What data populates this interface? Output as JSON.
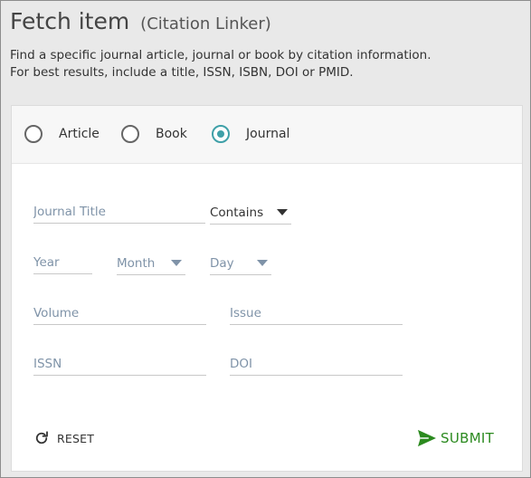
{
  "header": {
    "title": "Fetch item",
    "subtitle": "(Citation Linker)",
    "description_line1": "Find a specific journal article, journal or book by citation information.",
    "description_line2": "For best results, include a title, ISSN, ISBN, DOI or PMID."
  },
  "item_types": [
    {
      "label": "Article",
      "checked": false
    },
    {
      "label": "Book",
      "checked": false
    },
    {
      "label": "Journal",
      "checked": true
    }
  ],
  "form": {
    "journal_title": {
      "placeholder": "Journal Title",
      "value": ""
    },
    "match_mode": {
      "selected": "Contains"
    },
    "year": {
      "placeholder": "Year",
      "value": ""
    },
    "month": {
      "selected": "Month"
    },
    "day": {
      "selected": "Day"
    },
    "volume": {
      "placeholder": "Volume",
      "value": ""
    },
    "issue": {
      "placeholder": "Issue",
      "value": ""
    },
    "issn": {
      "placeholder": "ISSN",
      "value": ""
    },
    "doi": {
      "placeholder": "DOI",
      "value": ""
    }
  },
  "actions": {
    "reset_label": "RESET",
    "submit_label": "SUBMIT"
  },
  "icons": {
    "reset": "refresh-icon",
    "submit": "send-icon"
  },
  "colors": {
    "radio_checked": "#3fa0a8",
    "submit": "#2b8a1f",
    "placeholder": "#7f93a8"
  }
}
